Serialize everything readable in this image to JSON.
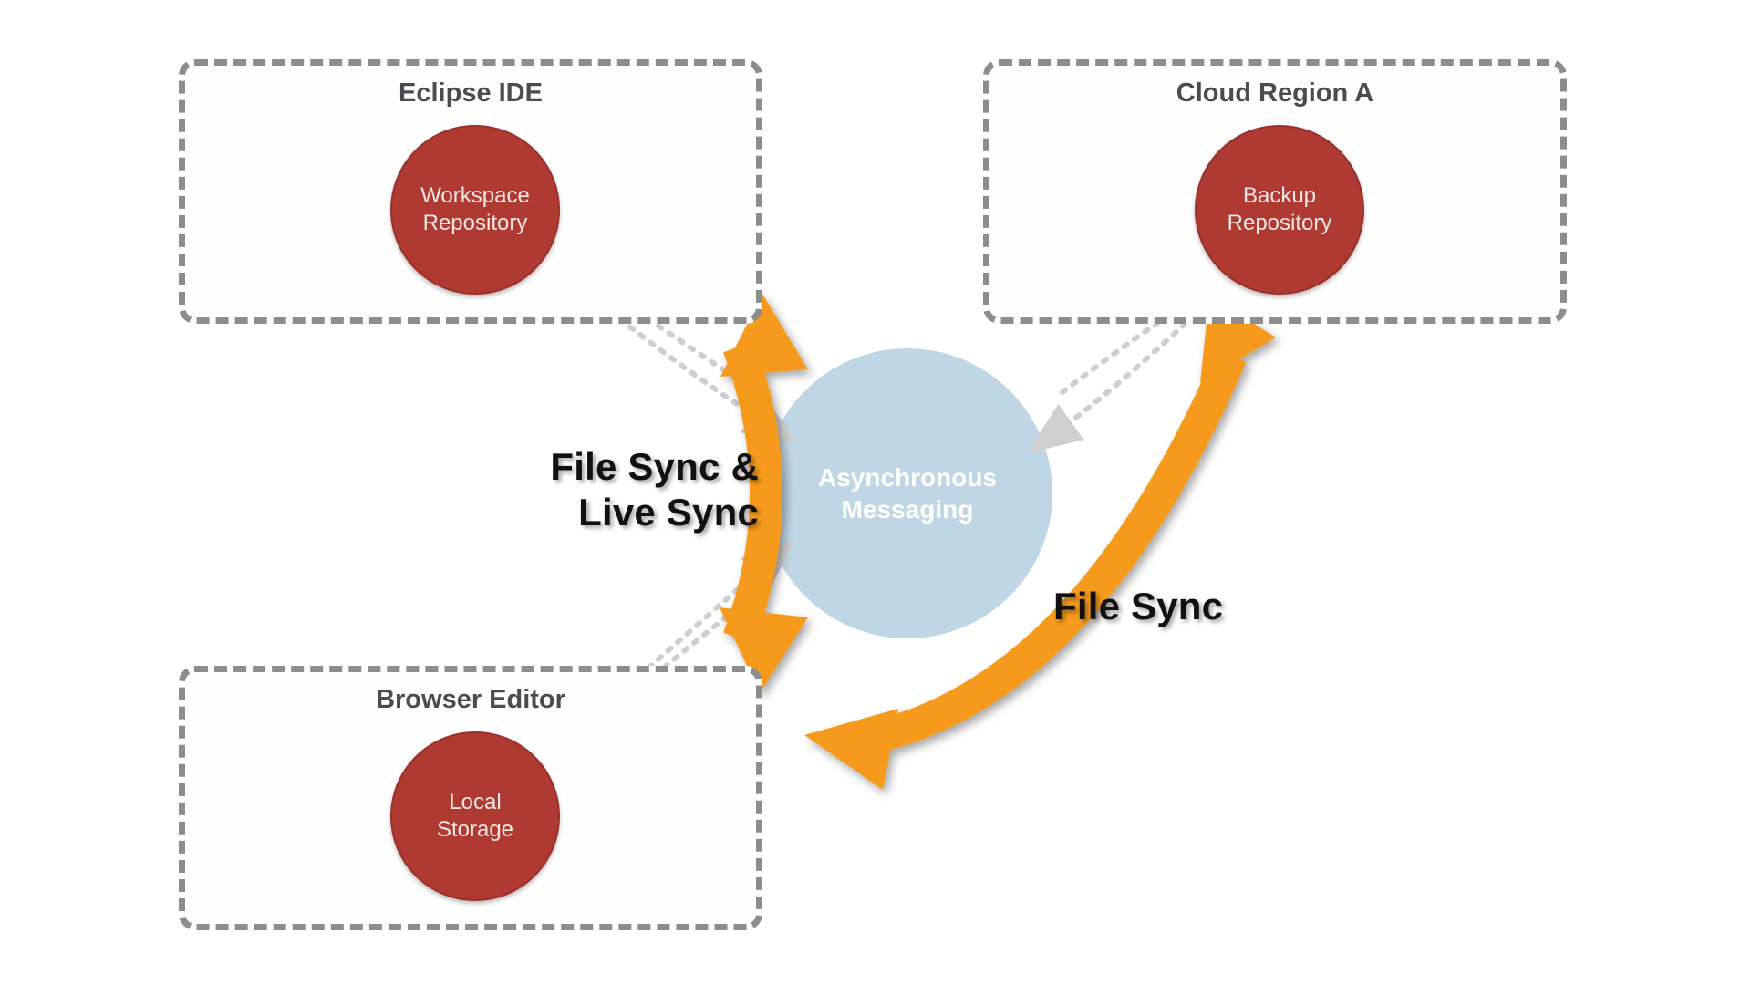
{
  "colors": {
    "border_gray": "#8d8d8d",
    "title_gray": "#4a4d50",
    "red_node": "#AF3A32",
    "red_node_border": "#993029",
    "blue_center": "#BFD6E4",
    "orange_arrow": "#F59A1B",
    "dotted_gray": "#cfcfcf"
  },
  "boxes": {
    "eclipse": {
      "title": "Eclipse IDE",
      "node_line1": "Workspace",
      "node_line2": "Repository"
    },
    "cloud": {
      "title": "Cloud Region A",
      "node_line1": "Backup",
      "node_line2": "Repository"
    },
    "browser": {
      "title": "Browser Editor",
      "node_line1": "Local",
      "node_line2": "Storage"
    }
  },
  "center": {
    "line1": "Asynchronous",
    "line2": "Messaging"
  },
  "labels": {
    "left_line1": "File Sync &",
    "left_line2": "Live Sync",
    "right": "File Sync"
  },
  "chart_data": {
    "type": "diagram",
    "nodes": [
      {
        "id": "eclipse",
        "label": "Eclipse IDE",
        "sub": "Workspace Repository"
      },
      {
        "id": "cloud",
        "label": "Cloud Region A",
        "sub": "Backup Repository"
      },
      {
        "id": "browser",
        "label": "Browser Editor",
        "sub": "Local Storage"
      },
      {
        "id": "hub",
        "label": "Asynchronous Messaging"
      }
    ],
    "edges": [
      {
        "from": "eclipse",
        "to": "hub",
        "style": "dotted",
        "bidirectional": true
      },
      {
        "from": "browser",
        "to": "hub",
        "style": "dotted",
        "bidirectional": true
      },
      {
        "from": "cloud",
        "to": "hub",
        "style": "dotted",
        "bidirectional": true
      },
      {
        "from": "eclipse",
        "to": "browser",
        "label": "File Sync & Live Sync",
        "style": "orange",
        "bidirectional": true
      },
      {
        "from": "cloud",
        "to": "browser",
        "label": "File Sync",
        "style": "orange",
        "bidirectional": true
      }
    ]
  }
}
